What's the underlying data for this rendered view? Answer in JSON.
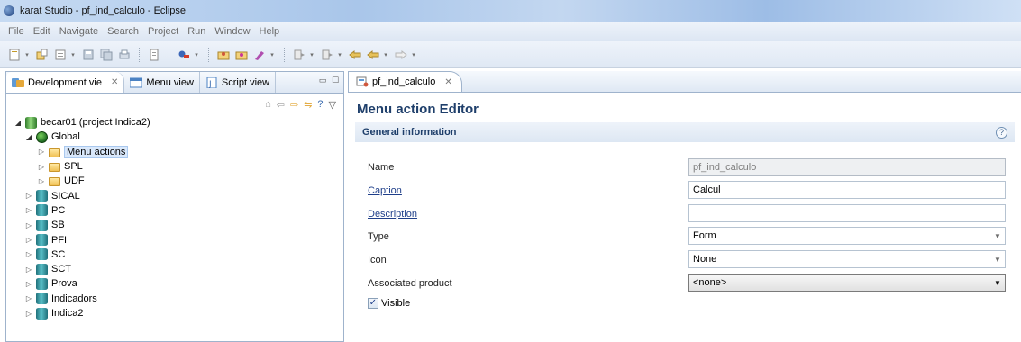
{
  "window": {
    "title": "karat Studio - pf_ind_calculo - Eclipse"
  },
  "menubar": {
    "items": [
      "File",
      "Edit",
      "Navigate",
      "Search",
      "Project",
      "Run",
      "Window",
      "Help"
    ]
  },
  "left_view": {
    "tabs": [
      {
        "label": "Development vie",
        "close": "✕"
      },
      {
        "label": "Menu view"
      },
      {
        "label": "Script view"
      }
    ],
    "tree": [
      {
        "label": "becar01 (project Indica2)",
        "level": 0,
        "expanded": true,
        "icon": "project-icon"
      },
      {
        "label": "Global",
        "level": 1,
        "expanded": true,
        "icon": "globe-icon"
      },
      {
        "label": "Menu actions",
        "level": 2,
        "expanded": false,
        "icon": "folder-icon",
        "selected": true
      },
      {
        "label": "SPL",
        "level": 2,
        "expanded": false,
        "icon": "folder-icon"
      },
      {
        "label": "UDF",
        "level": 2,
        "expanded": false,
        "icon": "folder-icon"
      },
      {
        "label": "SICAL",
        "level": 1,
        "expanded": false,
        "icon": "database-icon"
      },
      {
        "label": "PC",
        "level": 1,
        "expanded": false,
        "icon": "database-icon"
      },
      {
        "label": "SB",
        "level": 1,
        "expanded": false,
        "icon": "database-icon"
      },
      {
        "label": "PFI",
        "level": 1,
        "expanded": false,
        "icon": "database-icon"
      },
      {
        "label": "SC",
        "level": 1,
        "expanded": false,
        "icon": "database-icon"
      },
      {
        "label": "SCT",
        "level": 1,
        "expanded": false,
        "icon": "database-icon"
      },
      {
        "label": "Prova",
        "level": 1,
        "expanded": false,
        "icon": "database-icon"
      },
      {
        "label": "Indicadors",
        "level": 1,
        "expanded": false,
        "icon": "database-icon"
      },
      {
        "label": "Indica2",
        "level": 1,
        "expanded": false,
        "icon": "database-icon"
      }
    ]
  },
  "editor": {
    "tab": {
      "label": "pf_ind_calculo",
      "close": "✕"
    },
    "title": "Menu action Editor",
    "section": "General information",
    "help_glyph": "?",
    "fields": {
      "name": {
        "label": "Name",
        "value": "pf_ind_calculo"
      },
      "caption": {
        "label": "Caption",
        "value": "Calcul"
      },
      "description": {
        "label": "Description",
        "value": ""
      },
      "type": {
        "label": "Type",
        "value": "Form"
      },
      "icon": {
        "label": "Icon",
        "value": "None"
      },
      "associated_product": {
        "label": "Associated product",
        "value": "<none>"
      },
      "visible": {
        "label": "Visible",
        "checked": true
      }
    }
  },
  "colors": {
    "accent": "#1f3f6b",
    "link": "#1f3f8a",
    "chrome": "#dfe8f4"
  }
}
